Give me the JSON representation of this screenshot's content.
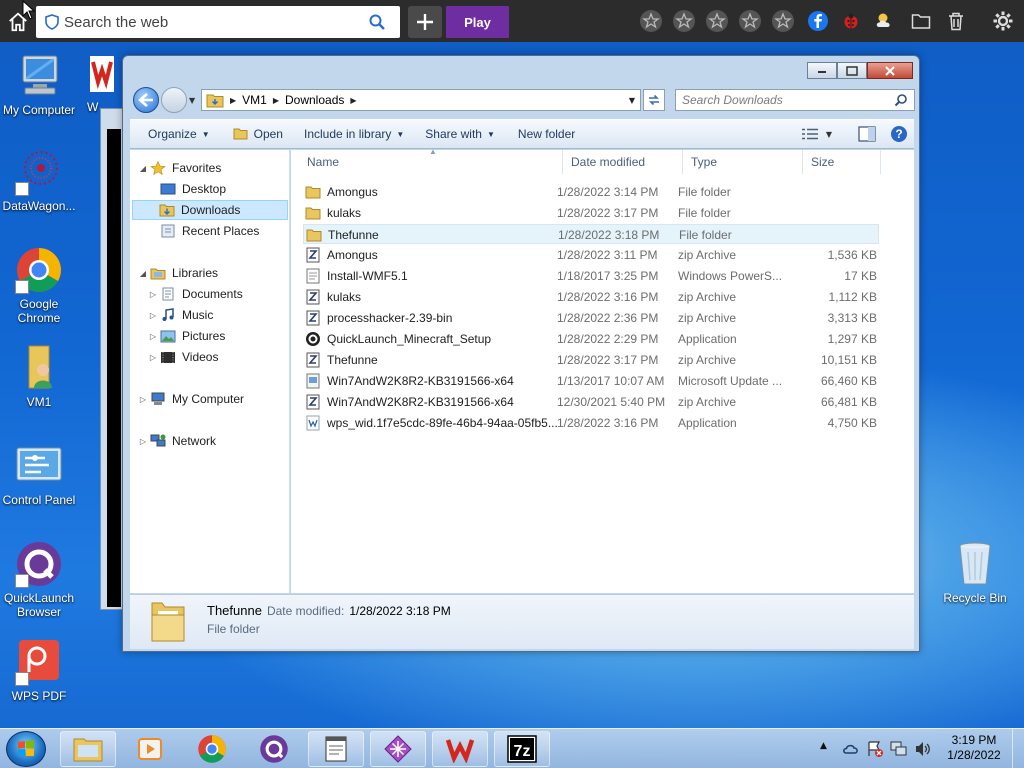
{
  "topbar": {
    "search_placeholder": "Search the web",
    "play_label": "Play",
    "icons": [
      "home-icon",
      "shield-icon",
      "search-icon",
      "plus-icon",
      "star-icon",
      "star-icon",
      "star-icon",
      "star-icon",
      "star-icon",
      "facebook-icon",
      "ladybug-icon",
      "weather-icon",
      "folder-icon",
      "trash-icon",
      "gear-icon"
    ]
  },
  "desktop": {
    "icons": [
      {
        "label": "My Computer"
      },
      {
        "label": "W"
      },
      {
        "label": "DataWagon..."
      },
      {
        "label": "Google Chrome"
      },
      {
        "label": "VM1"
      },
      {
        "label": "Control Panel"
      },
      {
        "label": "QuickLaunch Browser"
      },
      {
        "label": "WPS PDF"
      },
      {
        "label": "Recycle Bin"
      }
    ]
  },
  "explorer": {
    "breadcrumb": [
      "VM1",
      "Downloads"
    ],
    "search_placeholder": "Search Downloads",
    "toolbar": {
      "organize": "Organize",
      "open": "Open",
      "include": "Include in library",
      "share": "Share with",
      "new_folder": "New folder"
    },
    "nav": {
      "favorites": "Favorites",
      "desktop": "Desktop",
      "downloads": "Downloads",
      "recent": "Recent Places",
      "libraries": "Libraries",
      "documents": "Documents",
      "music": "Music",
      "pictures": "Pictures",
      "videos": "Videos",
      "computer": "My Computer",
      "network": "Network"
    },
    "columns": {
      "name": "Name",
      "date": "Date modified",
      "type": "Type",
      "size": "Size"
    },
    "files": [
      {
        "name": "Amongus",
        "date": "1/28/2022 3:14 PM",
        "type": "File folder",
        "size": "",
        "icon": "folder-icon"
      },
      {
        "name": "kulaks",
        "date": "1/28/2022 3:17 PM",
        "type": "File folder",
        "size": "",
        "icon": "folder-icon"
      },
      {
        "name": "Thefunne",
        "date": "1/28/2022 3:18 PM",
        "type": "File folder",
        "size": "",
        "icon": "folder-icon"
      },
      {
        "name": "Amongus",
        "date": "1/28/2022 3:11 PM",
        "type": "zip Archive",
        "size": "1,536 KB",
        "icon": "zip-icon"
      },
      {
        "name": "Install-WMF5.1",
        "date": "1/18/2017 3:25 PM",
        "type": "Windows PowerS...",
        "size": "17 KB",
        "icon": "script-icon"
      },
      {
        "name": "kulaks",
        "date": "1/28/2022 3:16 PM",
        "type": "zip Archive",
        "size": "1,112 KB",
        "icon": "zip-icon"
      },
      {
        "name": "processhacker-2.39-bin",
        "date": "1/28/2022 2:36 PM",
        "type": "zip Archive",
        "size": "3,313 KB",
        "icon": "zip-icon"
      },
      {
        "name": "QuickLaunch_Minecraft_Setup",
        "date": "1/28/2022 2:29 PM",
        "type": "Application",
        "size": "1,297 KB",
        "icon": "app-icon"
      },
      {
        "name": "Thefunne",
        "date": "1/28/2022 3:17 PM",
        "type": "zip Archive",
        "size": "10,151 KB",
        "icon": "zip-icon"
      },
      {
        "name": "Win7AndW2K8R2-KB3191566-x64",
        "date": "1/13/2017 10:07 AM",
        "type": "Microsoft Update ...",
        "size": "66,460 KB",
        "icon": "update-icon"
      },
      {
        "name": "Win7AndW2K8R2-KB3191566-x64",
        "date": "12/30/2021 5:40 PM",
        "type": "zip Archive",
        "size": "66,481 KB",
        "icon": "zip-icon"
      },
      {
        "name": "wps_wid.1f7e5cdc-89fe-46b4-94aa-05fb5...",
        "date": "1/28/2022 3:16 PM",
        "type": "Application",
        "size": "4,750 KB",
        "icon": "wps-icon"
      }
    ],
    "details": {
      "name": "Thefunne",
      "date_label": "Date modified:",
      "date": "1/28/2022 3:18 PM",
      "type": "File folder"
    }
  },
  "taskbar": {
    "time": "3:19 PM",
    "date": "1/28/2022"
  },
  "colors": {
    "accent": "#6e2da0",
    "selection": "#cce8ff",
    "desktop": "#1267d2"
  }
}
